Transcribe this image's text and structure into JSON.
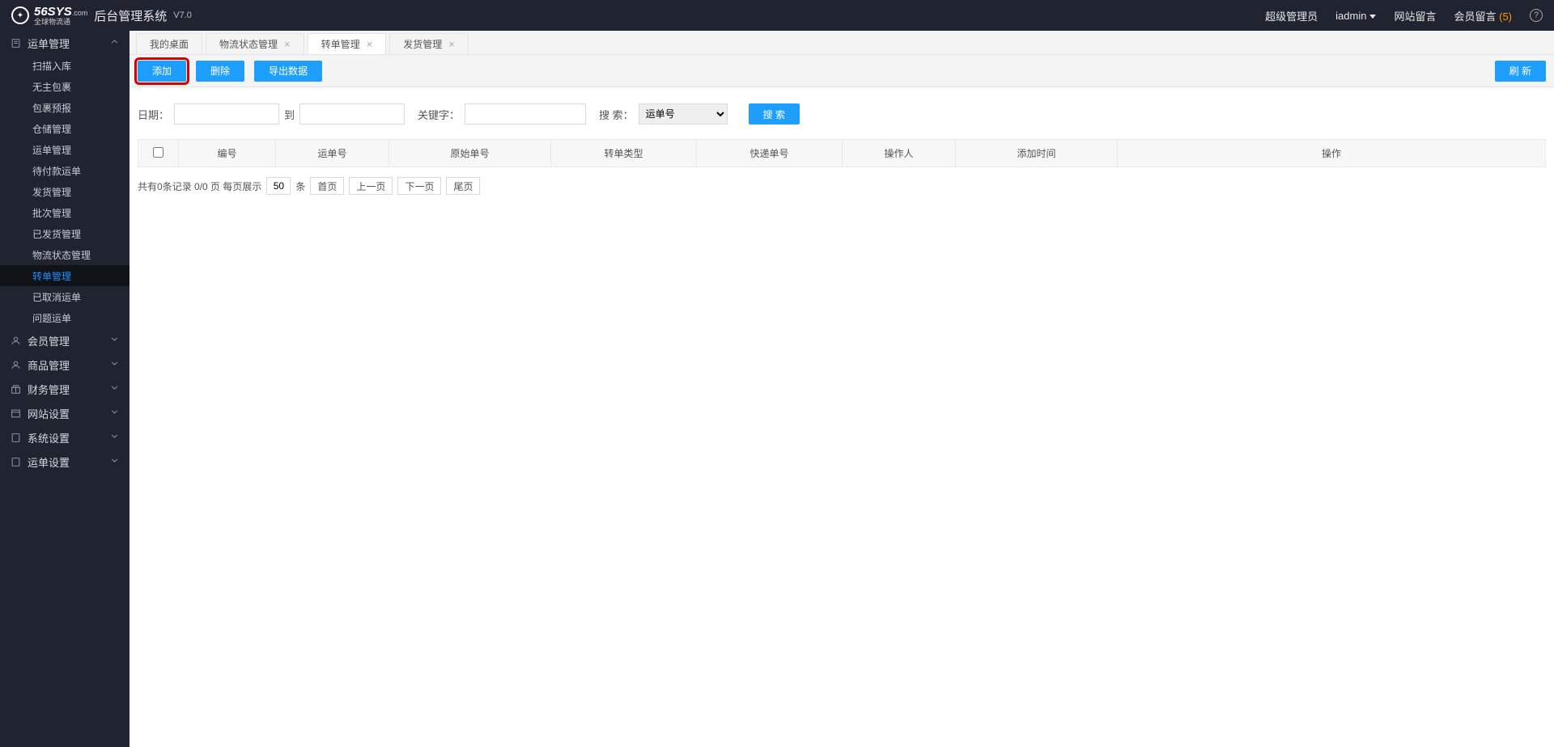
{
  "header": {
    "logo_main": "56SYS",
    "logo_suffix": ".com",
    "logo_tag": "全球物流通",
    "title": "后台管理系统",
    "version": "V7.0",
    "role": "超级管理员",
    "username": "iadmin",
    "site_msg": "网站留言",
    "member_msg": "会员留言",
    "member_msg_count": "(5)"
  },
  "sidebar": {
    "menu": [
      {
        "label": "运单管理",
        "expanded": true,
        "icon": "doc"
      },
      {
        "label": "会员管理",
        "expanded": false,
        "icon": "user"
      },
      {
        "label": "商品管理",
        "expanded": false,
        "icon": "user"
      },
      {
        "label": "财务管理",
        "expanded": false,
        "icon": "gift"
      },
      {
        "label": "网站设置",
        "expanded": false,
        "icon": "layout"
      },
      {
        "label": "系统设置",
        "expanded": false,
        "icon": "doc"
      },
      {
        "label": "运单设置",
        "expanded": false,
        "icon": "doc"
      }
    ],
    "sub_waybill": [
      "扫描入库",
      "无主包裹",
      "包裹预报",
      "仓储管理",
      "运单管理",
      "待付款运单",
      "发货管理",
      "批次管理",
      "已发货管理",
      "物流状态管理",
      "转单管理",
      "已取消运单",
      "问题运单"
    ],
    "active_sub_index": 10
  },
  "tabs": [
    {
      "label": "我的桌面",
      "closable": false,
      "active": false
    },
    {
      "label": "物流状态管理",
      "closable": true,
      "active": false
    },
    {
      "label": "转单管理",
      "closable": true,
      "active": true
    },
    {
      "label": "发货管理",
      "closable": true,
      "active": false
    }
  ],
  "toolbar": {
    "add": "添加",
    "delete": "删除",
    "export": "导出数据",
    "refresh": "刷 新"
  },
  "filter": {
    "date_label": "日期：",
    "to_label": "到",
    "keyword_label": "关键字：",
    "search_type_label": "搜 索：",
    "search_type_value": "运单号",
    "search_btn": "搜 索"
  },
  "table": {
    "headers": [
      "编号",
      "运单号",
      "原始单号",
      "转单类型",
      "快递单号",
      "操作人",
      "添加时间",
      "操作"
    ]
  },
  "pagination": {
    "summary_prefix": "共有",
    "total": "0",
    "summary_mid": "条记录  0/0 页  每页展示",
    "page_size": "50",
    "unit": "条",
    "first": "首页",
    "prev": "上一页",
    "next": "下一页",
    "last": "尾页"
  }
}
